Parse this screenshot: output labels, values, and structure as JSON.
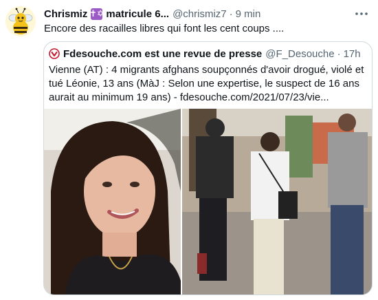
{
  "tweet": {
    "author_name": "Chrismiz",
    "name_emoji": "✝✡",
    "author_name_suffix": "matricule 6...",
    "handle": "@chrismiz7",
    "separator": "·",
    "time": "9 min",
    "more_icon": "more-icon",
    "text": "Encore des racailles libres qui font les cent coups ...."
  },
  "quote": {
    "icon": "checkmark-badge-icon",
    "author_name": "Fdesouche.com est une revue de presse",
    "handle": "@F_Desouche",
    "separator": "·",
    "time": "17h",
    "text": "Vienne (AT) : 4 migrants afghans soupçonnés d'avoir drogué, violé et tué Léonie, 13 ans (MàJ : Selon une expertise, le suspect de 16 ans aurait au minimum 19 ans) - fdesouche.com/2021/07/23/vie..."
  },
  "colors": {
    "text": "#0f1419",
    "secondary": "#536471",
    "border": "#cfd9de",
    "accent_red": "#c4182c"
  }
}
